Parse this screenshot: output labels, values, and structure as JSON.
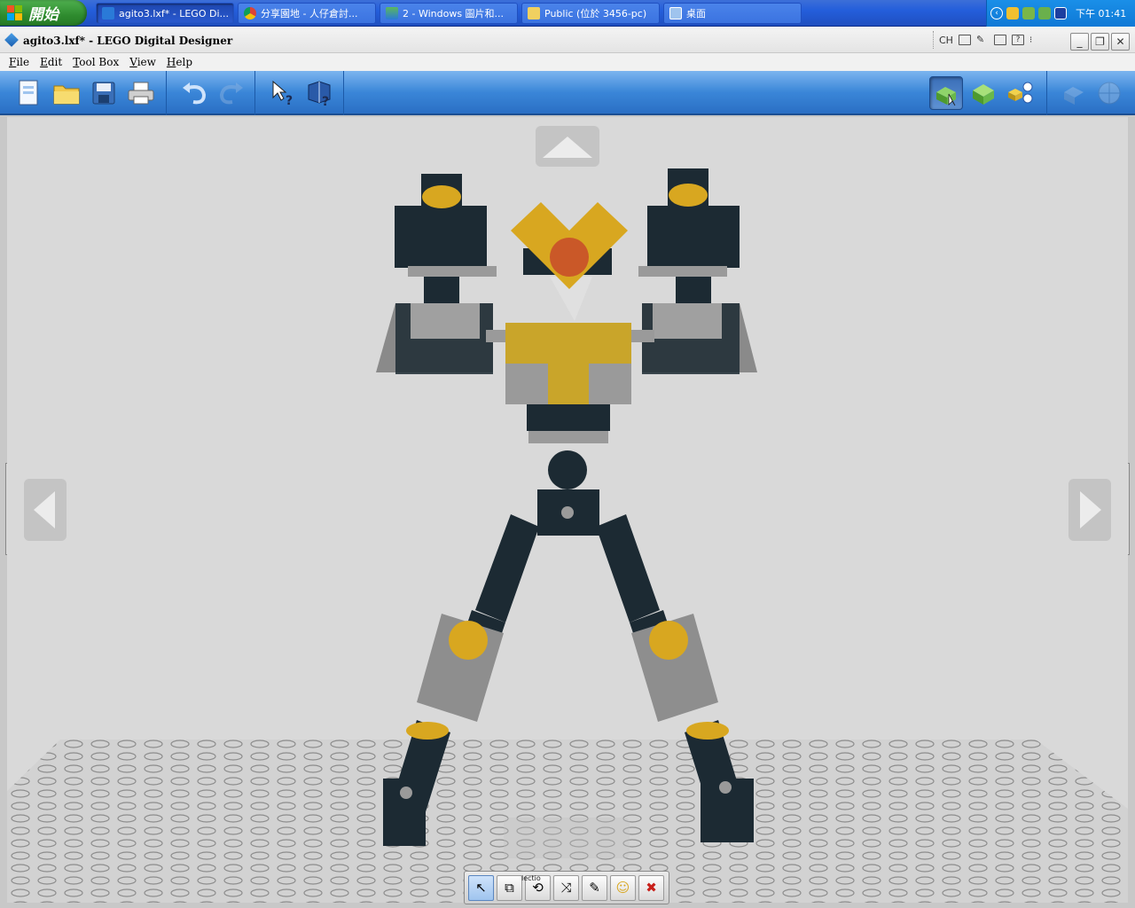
{
  "taskbar": {
    "start_label": "開始",
    "tasks": [
      {
        "label": "agito3.lxf* - LEGO Di...",
        "icon": "lego-icon",
        "active": true
      },
      {
        "label": "分享園地 - 人仔倉討...",
        "icon": "chrome-icon",
        "active": false
      },
      {
        "label": "2 - Windows 圖片和...",
        "icon": "picture-viewer-icon",
        "active": false
      },
      {
        "label": "Public (位於 3456-pc)",
        "icon": "folder-icon",
        "active": false
      },
      {
        "label": "桌面",
        "icon": "desktop-icon",
        "active": false
      }
    ],
    "clock": "下午 01:41"
  },
  "window": {
    "title": "agito3.lxf* - LEGO Digital Designer",
    "langbar_label": "CH"
  },
  "menu": {
    "items": [
      "File",
      "Edit",
      "Tool Box",
      "View",
      "Help"
    ]
  },
  "toolbar": {
    "buttons": [
      {
        "name": "new-button",
        "icon": "new-document-icon",
        "glyph": "🗋"
      },
      {
        "name": "open-button",
        "icon": "folder-open-icon",
        "glyph": "📁"
      },
      {
        "name": "save-button",
        "icon": "save-icon",
        "glyph": "💾"
      },
      {
        "name": "print-button",
        "icon": "printer-icon",
        "glyph": "🖨"
      },
      {
        "name": "undo-button",
        "icon": "undo-icon",
        "glyph": "↶"
      },
      {
        "name": "redo-button",
        "icon": "redo-icon",
        "glyph": "↷"
      },
      {
        "name": "help-pointer-button",
        "icon": "help-pointer-icon",
        "glyph": "↖?"
      },
      {
        "name": "help-book-button",
        "icon": "help-book-icon",
        "glyph": "📘"
      },
      {
        "name": "build-mode-button",
        "icon": "build-mode-icon",
        "glyph": "▦"
      },
      {
        "name": "view-mode-button",
        "icon": "view-mode-icon",
        "glyph": "▣"
      },
      {
        "name": "building-guide-button",
        "icon": "building-guide-icon",
        "glyph": "▤"
      },
      {
        "name": "share-button",
        "icon": "share-icon",
        "glyph": "⚙"
      },
      {
        "name": "web-button",
        "icon": "globe-icon",
        "glyph": "🌐"
      }
    ]
  },
  "bottom_toolbox": {
    "tools": [
      {
        "name": "select-tool",
        "icon": "cursor-icon",
        "glyph": "↖"
      },
      {
        "name": "clone-tool",
        "icon": "clone-icon",
        "glyph": "⧉"
      },
      {
        "name": "hinge-tool",
        "icon": "hinge-icon",
        "glyph": "⟲"
      },
      {
        "name": "hinge-align-tool",
        "icon": "hinge-align-icon",
        "glyph": "⤨"
      },
      {
        "name": "paint-tool",
        "icon": "paint-icon",
        "glyph": "✎"
      },
      {
        "name": "decoration-tool",
        "icon": "decoration-icon",
        "glyph": "☺"
      },
      {
        "name": "delete-tool",
        "icon": "delete-icon",
        "glyph": "✖"
      }
    ],
    "tooltip": "lectio"
  },
  "colors": {
    "brick_dark": "#1c2a33",
    "brick_yellow": "#d8a720",
    "brick_gray": "#9a9a9a",
    "toolbar_blue": "#3a86d8",
    "viewport_bg": "#d9d9d9"
  }
}
